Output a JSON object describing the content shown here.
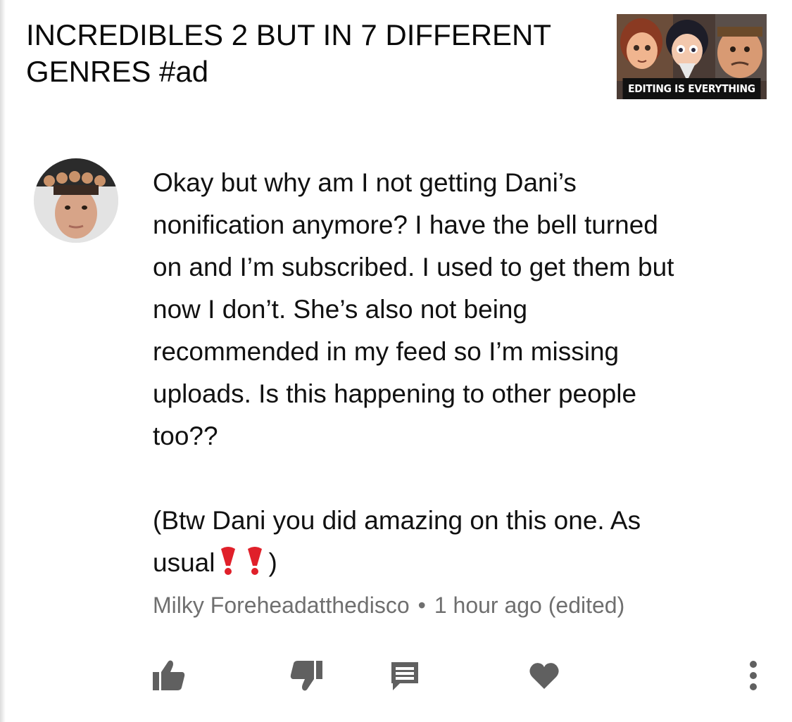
{
  "video": {
    "title": "INCREDIBLES 2 BUT IN 7 DIFFERENT GENRES #ad",
    "thumbnail_caption": "EDITING IS EVERYTHING"
  },
  "comment": {
    "text_line1": "Okay but why am I not getting Dani’s",
    "text_line2": "nonification anymore? I have the bell turned",
    "text_line3": "on and I’m subscribed. I used to get them but",
    "text_line4": "now I don’t. She’s also not being",
    "text_line5": "recommended in my feed so I’m missing",
    "text_line6": "uploads. Is this happening to other people",
    "text_line7": "too??",
    "text_line8": "(Btw Dani you did amazing on this one. As",
    "text_line9_start": "usual",
    "text_line9_end": ")",
    "emoji": "heavy-exclamation-mark-icon",
    "author": "Milky Foreheadatthedisco",
    "separator": "•",
    "timestamp": "1 hour ago (edited)"
  },
  "actions": {
    "like_icon": "thumbs-up-icon",
    "dislike_icon": "thumbs-down-icon",
    "reply_icon": "comment-icon",
    "heart_icon": "heart-icon",
    "more_icon": "more-vertical-icon"
  },
  "colors": {
    "text": "#111111",
    "meta": "#6f6f6f",
    "icon": "#606060",
    "exclaim": "#e0202a"
  }
}
